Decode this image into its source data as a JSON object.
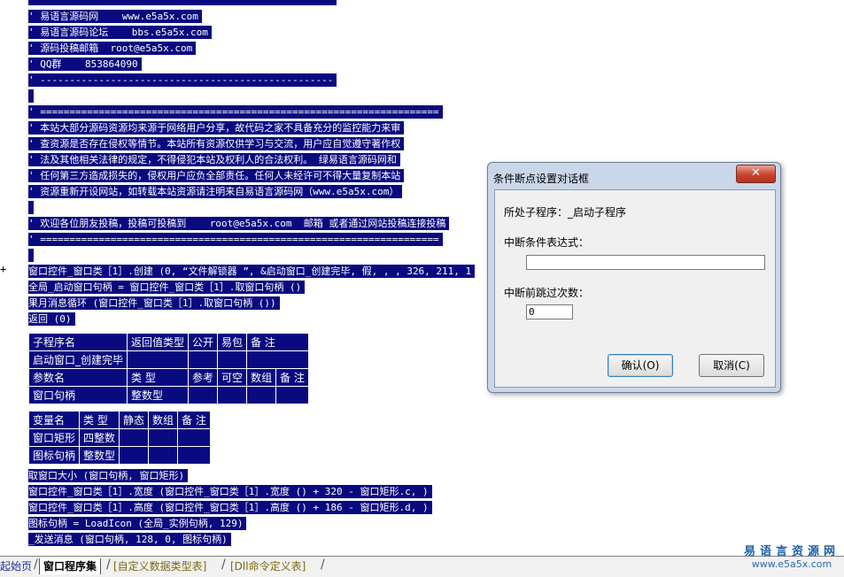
{
  "editor": {
    "lines": [
      "' ==================================================",
      "' 易语言源码网    www.e5a5x.com",
      "' 易语言源码论坛    bbs.e5a5x.com",
      "' 源码投稿邮箱  root@e5a5x.com",
      "' QQ群    853864090",
      "' --------------------------------------------------",
      "",
      "' ====================================================================",
      "' 本站大部分源码资源均来源于网络用户分享，故代码之家不具备充分的监控能力来审",
      "' 查资源是否存在侵权等情节。本站所有资源仅供学习与交流，用户应自觉遵守著作权",
      "' 法及其他相关法律的规定，不得侵犯本站及权利人的合法权利。 绿易语言源码网和",
      "' 任何第三方造成损失的，侵权用户应负全部责任。任何人未经许可不得大量复制本站",
      "' 资源重新开设网站，如转载本站资源请注明来自易语言源码网（www.e5a5x.com）",
      "",
      "' 欢迎各位朋友投稿，投稿可投稿到    root@e5a5x.com  邮箱 或者通过网站投稿连接投稿",
      "' ====================================================================",
      "",
      "窗口控件_窗口类［1］.创建 (0, “文件解锁器 ”, &启动窗口_创建完毕, 假, , , 326, 211, 1",
      "全局_启动窗口句柄 = 窗口控件_窗口类［1］.取窗口句柄 ()",
      "果月消息循环 (窗口控件_窗口类［1］.取窗口句柄 ())",
      "返回 (0)"
    ],
    "gutter_mark": "+",
    "sub_table": {
      "header": [
        "子程序名",
        "返回值类型",
        "公开",
        "易包",
        "备 注"
      ],
      "row": [
        "启动窗口_创建完毕",
        "",
        "",
        "",
        ""
      ],
      "param_header": [
        "参数名",
        "类 型",
        "参考",
        "可空",
        "数组",
        "备 注"
      ],
      "param_row": [
        "窗口句柄",
        "整数型",
        "",
        "",
        "",
        ""
      ]
    },
    "var_table": {
      "header": [
        "变量名",
        "类 型",
        "静态",
        "数组",
        "备 注"
      ],
      "rows": [
        [
          "窗口矩形",
          "四整数",
          "",
          "",
          ""
        ],
        [
          "图标句柄",
          "整数型",
          "",
          "",
          ""
        ]
      ]
    },
    "lines_after": [
      "取窗口大小 (窗口句柄, 窗口矩形)",
      "窗口控件_窗口类［1］.宽度 (窗口控件_窗口类［1］.宽度 () + 320 - 窗口矩形.c, )",
      "窗口控件_窗口类［1］.高度 (窗口控件_窗口类［1］.高度 () + 186 - 窗口矩形.d, )",
      "图标句柄 = LoadIcon (全局_实例句柄, 129)",
      "_发送消息 (窗口句柄, 128, 0, 图标句柄)"
    ]
  },
  "dialog": {
    "title": "条件断点设置对话框",
    "close_glyph": "✕",
    "subprogram_label": "所处子程序：_启动子程序",
    "condition_label": "中断条件表达式：",
    "condition_value": "",
    "skip_label": "中断前跳过次数：",
    "skip_value": "0",
    "ok_label": "确认(O)",
    "cancel_label": "取消(C)"
  },
  "tabs": [
    {
      "label": "起始页"
    },
    {
      "label": "窗口程序集"
    },
    {
      "label": "[自定义数据类型表]"
    },
    {
      "label": "[Dll命令定义表]"
    }
  ],
  "logo": {
    "cn": "易语言资源网",
    "url": "www.e5a5x.com"
  },
  "colors": {
    "code_bg": "#0a0a80",
    "code_fg": "#ffffff",
    "dialog_frame": "#c9d7e8",
    "close_button": "#c7432e"
  }
}
